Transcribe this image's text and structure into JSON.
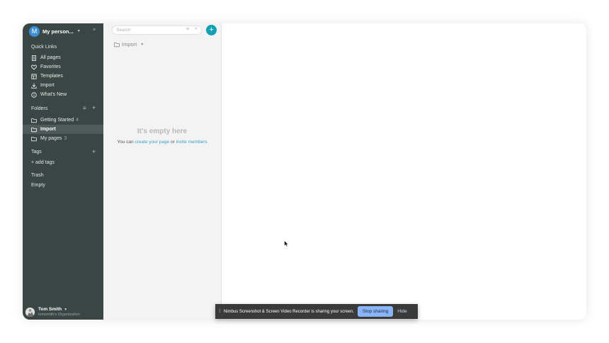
{
  "workspace": {
    "initial": "M",
    "name": "My person..."
  },
  "sidebar": {
    "quick_links_title": "Quick Links",
    "quick_links": [
      {
        "label": "All pages",
        "icon": "page-icon"
      },
      {
        "label": "Favorites",
        "icon": "heart-icon"
      },
      {
        "label": "Templates",
        "icon": "template-icon"
      },
      {
        "label": "Import",
        "icon": "download-icon"
      },
      {
        "label": "What's New",
        "icon": "info-icon"
      }
    ],
    "folders_title": "Folders",
    "folders": [
      {
        "label": "Getting Started",
        "count": "4"
      },
      {
        "label": "Import",
        "count": ""
      },
      {
        "label": "My pages",
        "count": "3"
      }
    ],
    "tags_title": "Tags",
    "add_tags": "+ add tags",
    "trash_title": "Trash",
    "trash_empty": "Empty"
  },
  "user": {
    "name": "Tom Smith",
    "org": "tomsmith's Organization"
  },
  "middle": {
    "search_placeholder": "Search",
    "breadcrumb": "Import",
    "empty_title": "It's empty here",
    "empty_prefix": "You can ",
    "empty_link1": "create your page",
    "empty_mid": " or ",
    "empty_link2": "invite members"
  },
  "sharebar": {
    "message": "Nimbus Screenshot & Screen Video Recorder is sharing your screen.",
    "stop_label": "Stop sharing",
    "hide_label": "Hide"
  },
  "colors": {
    "sidebar_bg": "#3a4644",
    "accent": "#14a0b4",
    "link": "#3a9fc8",
    "stop_button": "#8ab4f8"
  }
}
